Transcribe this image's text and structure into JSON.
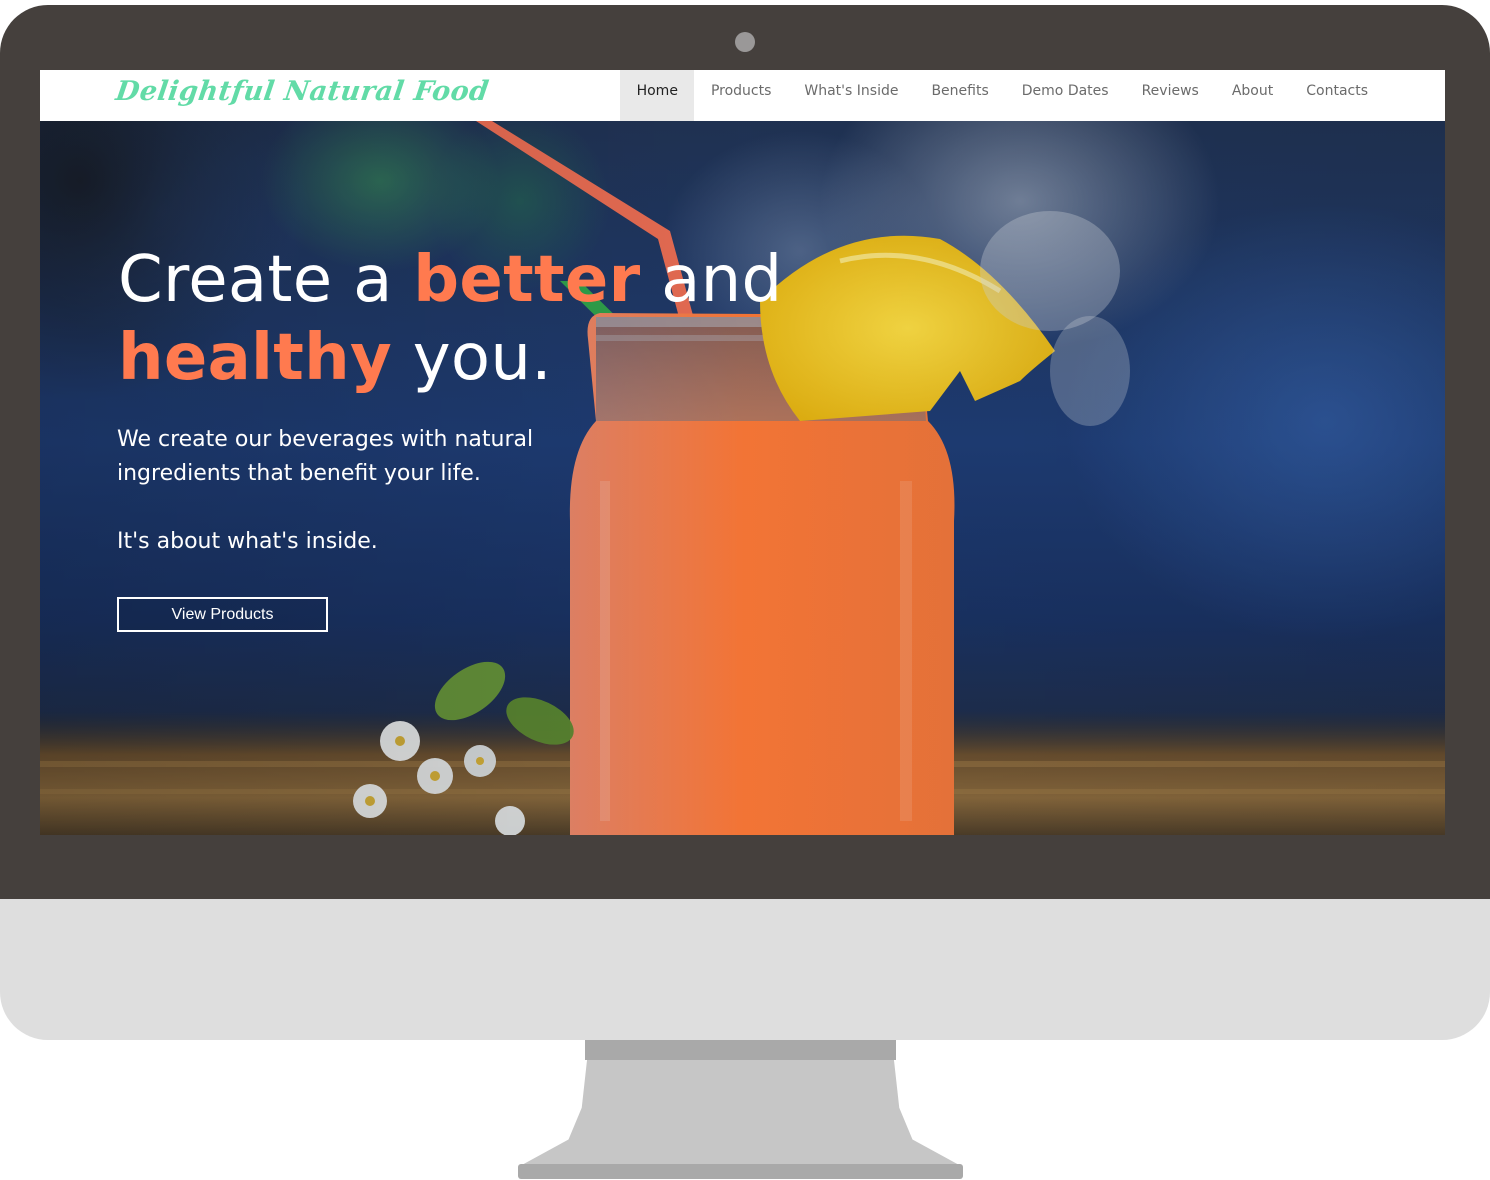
{
  "site": {
    "logo_text": "Delightful Natural Food"
  },
  "nav": {
    "items": [
      {
        "label": "Home",
        "active": true
      },
      {
        "label": "Products",
        "active": false
      },
      {
        "label": "What's Inside",
        "active": false
      },
      {
        "label": "Benefits",
        "active": false
      },
      {
        "label": "Demo Dates",
        "active": false
      },
      {
        "label": "Reviews",
        "active": false
      },
      {
        "label": "About",
        "active": false
      },
      {
        "label": "Contacts",
        "active": false
      }
    ]
  },
  "hero": {
    "headline": {
      "part1": "Create a ",
      "accent1": "better",
      "part2": " and",
      "accent2": "healthy",
      "part3": " you."
    },
    "subtext_line1": "We create our beverages with natural ingredients that benefit your life.",
    "subtext_line2": "It's about what's inside.",
    "cta_label": "View Products"
  },
  "colors": {
    "logo": "#62dba7",
    "accent": "#ff7a4f",
    "bezel": "#45403d",
    "chin": "#dedede",
    "nav_active_bg": "#e9e9e9"
  }
}
